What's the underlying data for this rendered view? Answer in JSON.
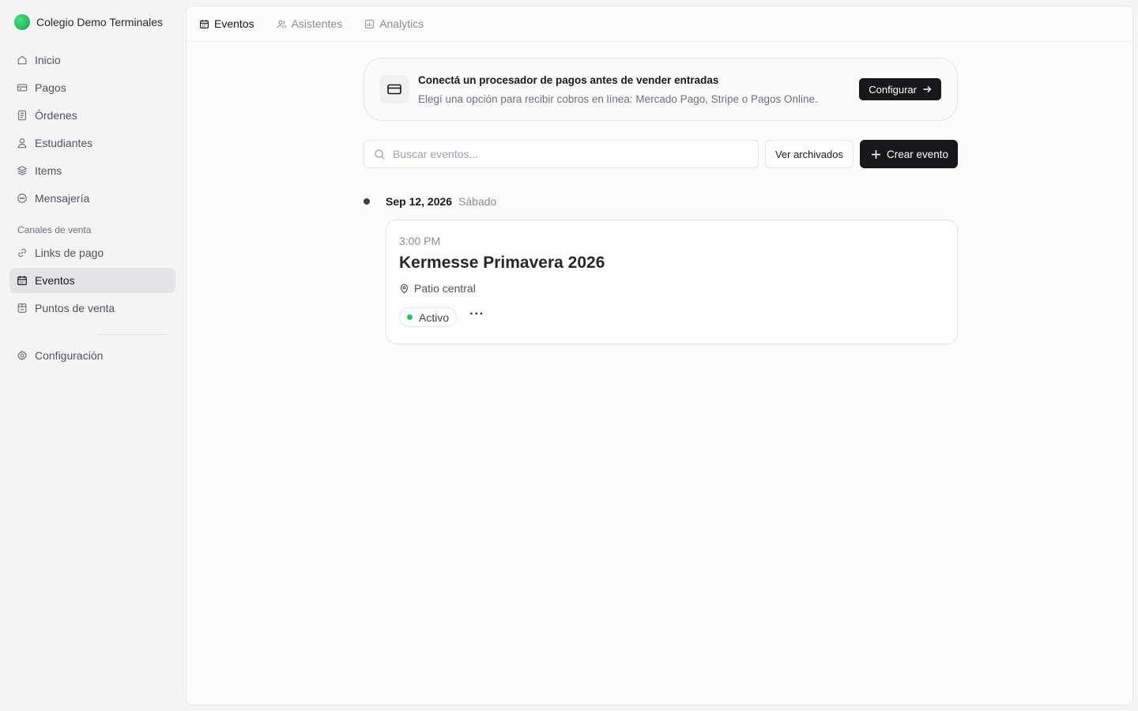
{
  "sidebar": {
    "org_name": "Colegio Demo Terminales",
    "items": [
      {
        "label": "Inicio",
        "icon": "home-icon"
      },
      {
        "label": "Pagos",
        "icon": "credit-card-icon"
      },
      {
        "label": "Órdenes",
        "icon": "receipt-icon"
      },
      {
        "label": "Estudiantes",
        "icon": "user-icon"
      },
      {
        "label": "Items",
        "icon": "layers-icon"
      },
      {
        "label": "Mensajería",
        "icon": "chat-icon"
      }
    ],
    "section_label": "Canales de venta",
    "channels": [
      {
        "label": "Links de pago",
        "icon": "link-icon"
      },
      {
        "label": "Eventos",
        "icon": "calendar-icon",
        "active": true
      },
      {
        "label": "Puntos de venta",
        "icon": "store-icon"
      }
    ],
    "settings_label": "Configuración"
  },
  "tabs": [
    {
      "label": "Eventos",
      "icon": "calendar-icon",
      "active": true
    },
    {
      "label": "Asistentes",
      "icon": "users-icon"
    },
    {
      "label": "Analytics",
      "icon": "bar-chart-icon"
    }
  ],
  "banner": {
    "title": "Conectá un procesador de pagos antes de vender entradas",
    "subtitle": "Elegí una opción para recibir cobros en línea: Mercado Pago, Stripe o Pagos Online.",
    "button_label": "Configurar"
  },
  "toolbar": {
    "search_placeholder": "Buscar eventos...",
    "archived_label": "Ver archivados",
    "create_label": "Crear evento"
  },
  "events_day": {
    "date": "Sep 12, 2026",
    "weekday": "Sábado",
    "event": {
      "time": "3:00 PM",
      "title": "Kermesse Primavera 2026",
      "location": "Patio central",
      "status": "Activo",
      "more_label": "···"
    }
  },
  "colors": {
    "accent_dark": "#18181b",
    "status_active": "#22c55e",
    "brand_logo": "#22c55e"
  }
}
